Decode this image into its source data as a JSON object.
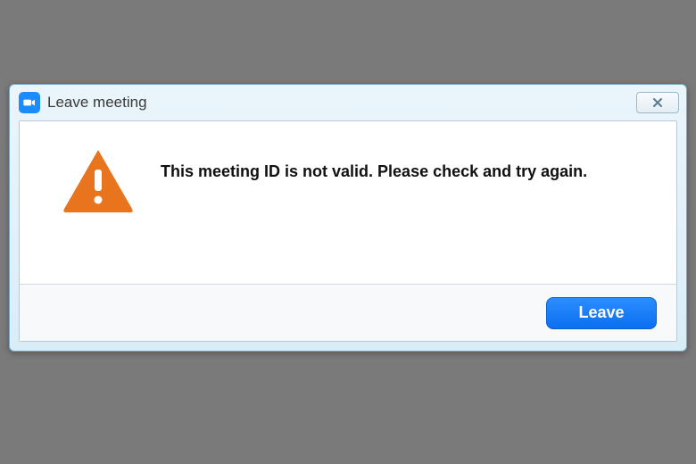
{
  "dialog": {
    "title": "Leave meeting",
    "message": "This meeting ID is not valid. Please check and try again.",
    "primary_button_label": "Leave"
  }
}
